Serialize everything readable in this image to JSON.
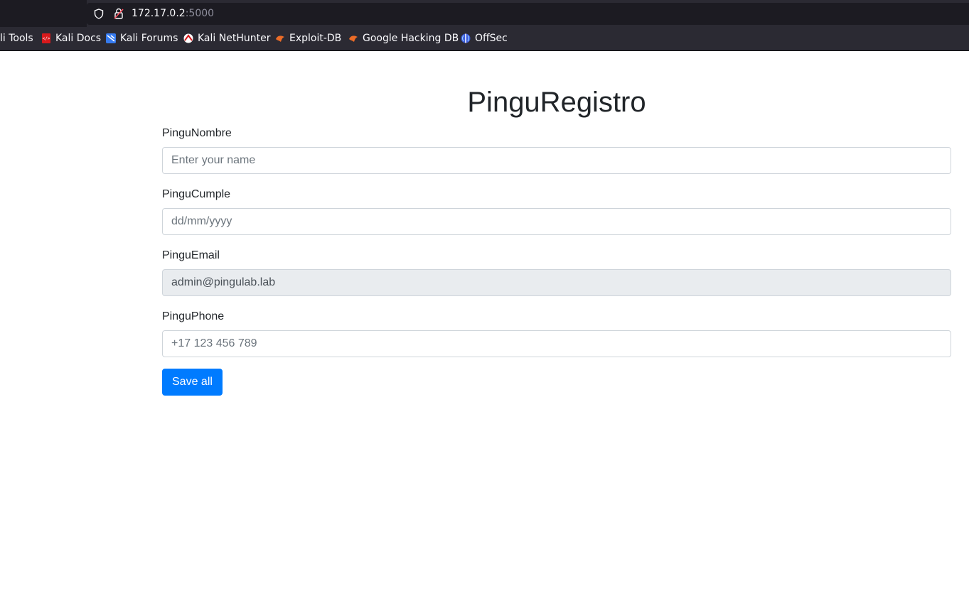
{
  "browser": {
    "url_host": "172.17.0.2",
    "url_port": ":5000",
    "bookmarks": [
      {
        "label": "li Tools",
        "icon": "kali-tools-icon"
      },
      {
        "label": "Kali Docs",
        "icon": "kali-docs-icon"
      },
      {
        "label": "Kali Forums",
        "icon": "kali-forums-icon"
      },
      {
        "label": "Kali NetHunter",
        "icon": "kali-nethunter-icon"
      },
      {
        "label": "Exploit-DB",
        "icon": "exploit-db-icon"
      },
      {
        "label": "Google Hacking DB",
        "icon": "google-hacking-db-icon"
      },
      {
        "label": "OffSec",
        "icon": "offsec-icon"
      }
    ]
  },
  "form": {
    "title": "PinguRegistro",
    "name_label": "PinguNombre",
    "name_placeholder": "Enter your name",
    "name_value": "",
    "birthday_label": "PinguCumple",
    "birthday_placeholder": "dd/mm/yyyy",
    "birthday_value": "",
    "email_label": "PinguEmail",
    "email_value": "admin@pingulab.lab",
    "phone_label": "PinguPhone",
    "phone_placeholder": "+17 123 456 789",
    "phone_value": "",
    "save_label": "Save all"
  },
  "colors": {
    "primary": "#007bff",
    "readonly_bg": "#e9ecef",
    "chrome_bg": "#2b2a33"
  }
}
